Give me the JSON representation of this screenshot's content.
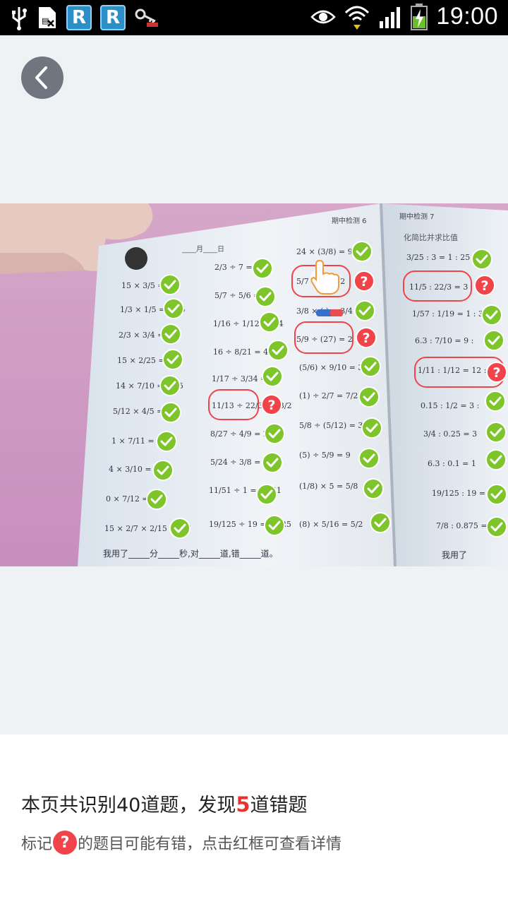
{
  "status_bar": {
    "time": "19:00",
    "left_icons": [
      "usb-icon",
      "sim-icon",
      "r-app-icon",
      "r-app-icon",
      "keys-icon"
    ],
    "right_icons": [
      "eye-icon",
      "wifi-icon",
      "signal-icon",
      "battery-charging-icon"
    ],
    "r_badge_letter": "R"
  },
  "back_button": {
    "icon": "chevron-left-icon"
  },
  "photo": {
    "page_heads": [
      "期中检测 6",
      "期中检测 7",
      "化简比并求比值"
    ],
    "footer_left": "我用了_____分_____秒,对_____道,错_____道。",
    "footer_right": "我用了",
    "wrong_marks": 5,
    "correct_marks": 35
  },
  "result": {
    "summary_prefix": "本页共识别40道题，发现",
    "summary_count": "5",
    "summary_suffix": "道错题",
    "hint_prefix": "标记",
    "hint_mark": "?",
    "hint_suffix": "的题目可能有错，点击红框可查看详情"
  },
  "colors": {
    "correct": "#7ec42b",
    "wrong": "#f0434a",
    "count_highlight": "#e8322d",
    "back_button": "#6f7680"
  }
}
